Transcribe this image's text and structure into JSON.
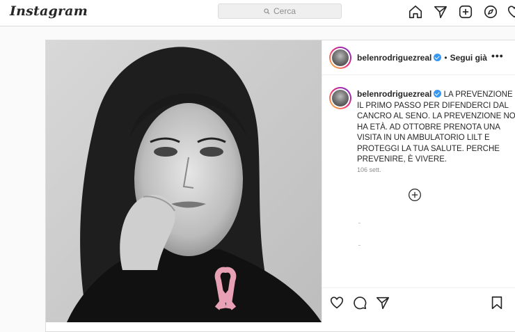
{
  "app": {
    "logo": "Instagram"
  },
  "search": {
    "placeholder": "Cerca"
  },
  "nav": {
    "icons": [
      "home-icon",
      "direct-icon",
      "new-post-icon",
      "explore-icon",
      "activity-icon"
    ]
  },
  "post": {
    "username": "belenrodriguezreal",
    "follow_status": "Segui già",
    "dot": "•",
    "more": "•••",
    "caption": "LA PREVENZIONE È IL PRIMO PASSO PER DIFENDERCI DAL CANCRO AL SENO. LA PREVENZIONE NON HA ETÀ. AD OTTOBRE PRENOTA UNA VISITA IN UN AMBULATORIO LILT E PROTEGGI LA TUA SALUTE. PERCHE PREVENIRE, È VIVERE.",
    "time": "106 sett.",
    "photo_description_icon": "pink-ribbon-icon"
  },
  "colors": {
    "accent": "#3897f0",
    "ribbon": "#e8a0b4",
    "border": "#dbdbdb"
  }
}
